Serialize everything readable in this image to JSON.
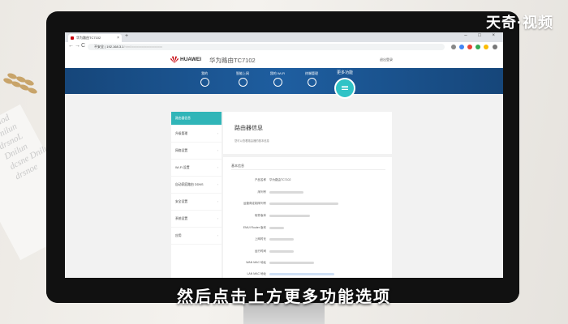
{
  "watermark": "天奇·视频",
  "subtitle": "然后点击上方更多功能选项",
  "background_text": [
    "Dniod Dnilun",
    "drsnoL Dnilun",
    "dcsne Dnilu",
    "drsnoe"
  ],
  "browser": {
    "tab_title": "华为路由TC7102",
    "tab_close": "×",
    "new_tab": "+",
    "window_controls": "– □ ×",
    "nav": {
      "back": "←",
      "forward": "→",
      "reload": "C"
    },
    "url_prefix": "不安全 | 192.168.3.1",
    "url_rest": "/html/xxxxxxxxxxxxxxxxxxx"
  },
  "router": {
    "brand": "HUAWEI",
    "title": "华为路由TC7102",
    "exit": "退出登录",
    "nav_items": [
      {
        "label": "我的",
        "icon": "home-icon"
      },
      {
        "label": "智能上网",
        "icon": "globe-icon"
      },
      {
        "label": "我的 Wi-Fi",
        "icon": "wifi-icon"
      },
      {
        "label": "终端管理",
        "icon": "user-icon"
      }
    ],
    "more": {
      "label": "更多功能",
      "icon": "menu-icon"
    },
    "sidebar": [
      {
        "label": "路由器信息",
        "active": true
      },
      {
        "label": "升级管理",
        "active": false
      },
      {
        "label": "网络设置",
        "active": false
      },
      {
        "label": "Wi-Fi 设置",
        "active": false
      },
      {
        "label": "自动家庭路由 DDNS",
        "active": false
      },
      {
        "label": "安全设置",
        "active": false
      },
      {
        "label": "系统设置",
        "active": false
      },
      {
        "label": "应用",
        "active": false
      }
    ],
    "panel": {
      "title": "路由器信息",
      "desc": "您可以查看路由器的基本信息",
      "section": "基本信息",
      "rows": [
        {
          "label": "产品名称",
          "value": "华为路由TC7102"
        },
        {
          "label": "序列号",
          "value": ""
        },
        {
          "label": "运营商定制序列号",
          "value": ""
        },
        {
          "label": "软件版本",
          "value": ""
        },
        {
          "label": "EMUI Router 版本",
          "value": ""
        },
        {
          "label": "上网时长",
          "value": ""
        },
        {
          "label": "运行时间",
          "value": ""
        },
        {
          "label": "WAN MAC 地址",
          "value": ""
        },
        {
          "label": "LAN MAC 地址",
          "value": ""
        }
      ]
    }
  },
  "colors": {
    "accent": "#30b5b8",
    "nav_bar": "#1e5ea0",
    "huawei_red": "#c7000b"
  }
}
